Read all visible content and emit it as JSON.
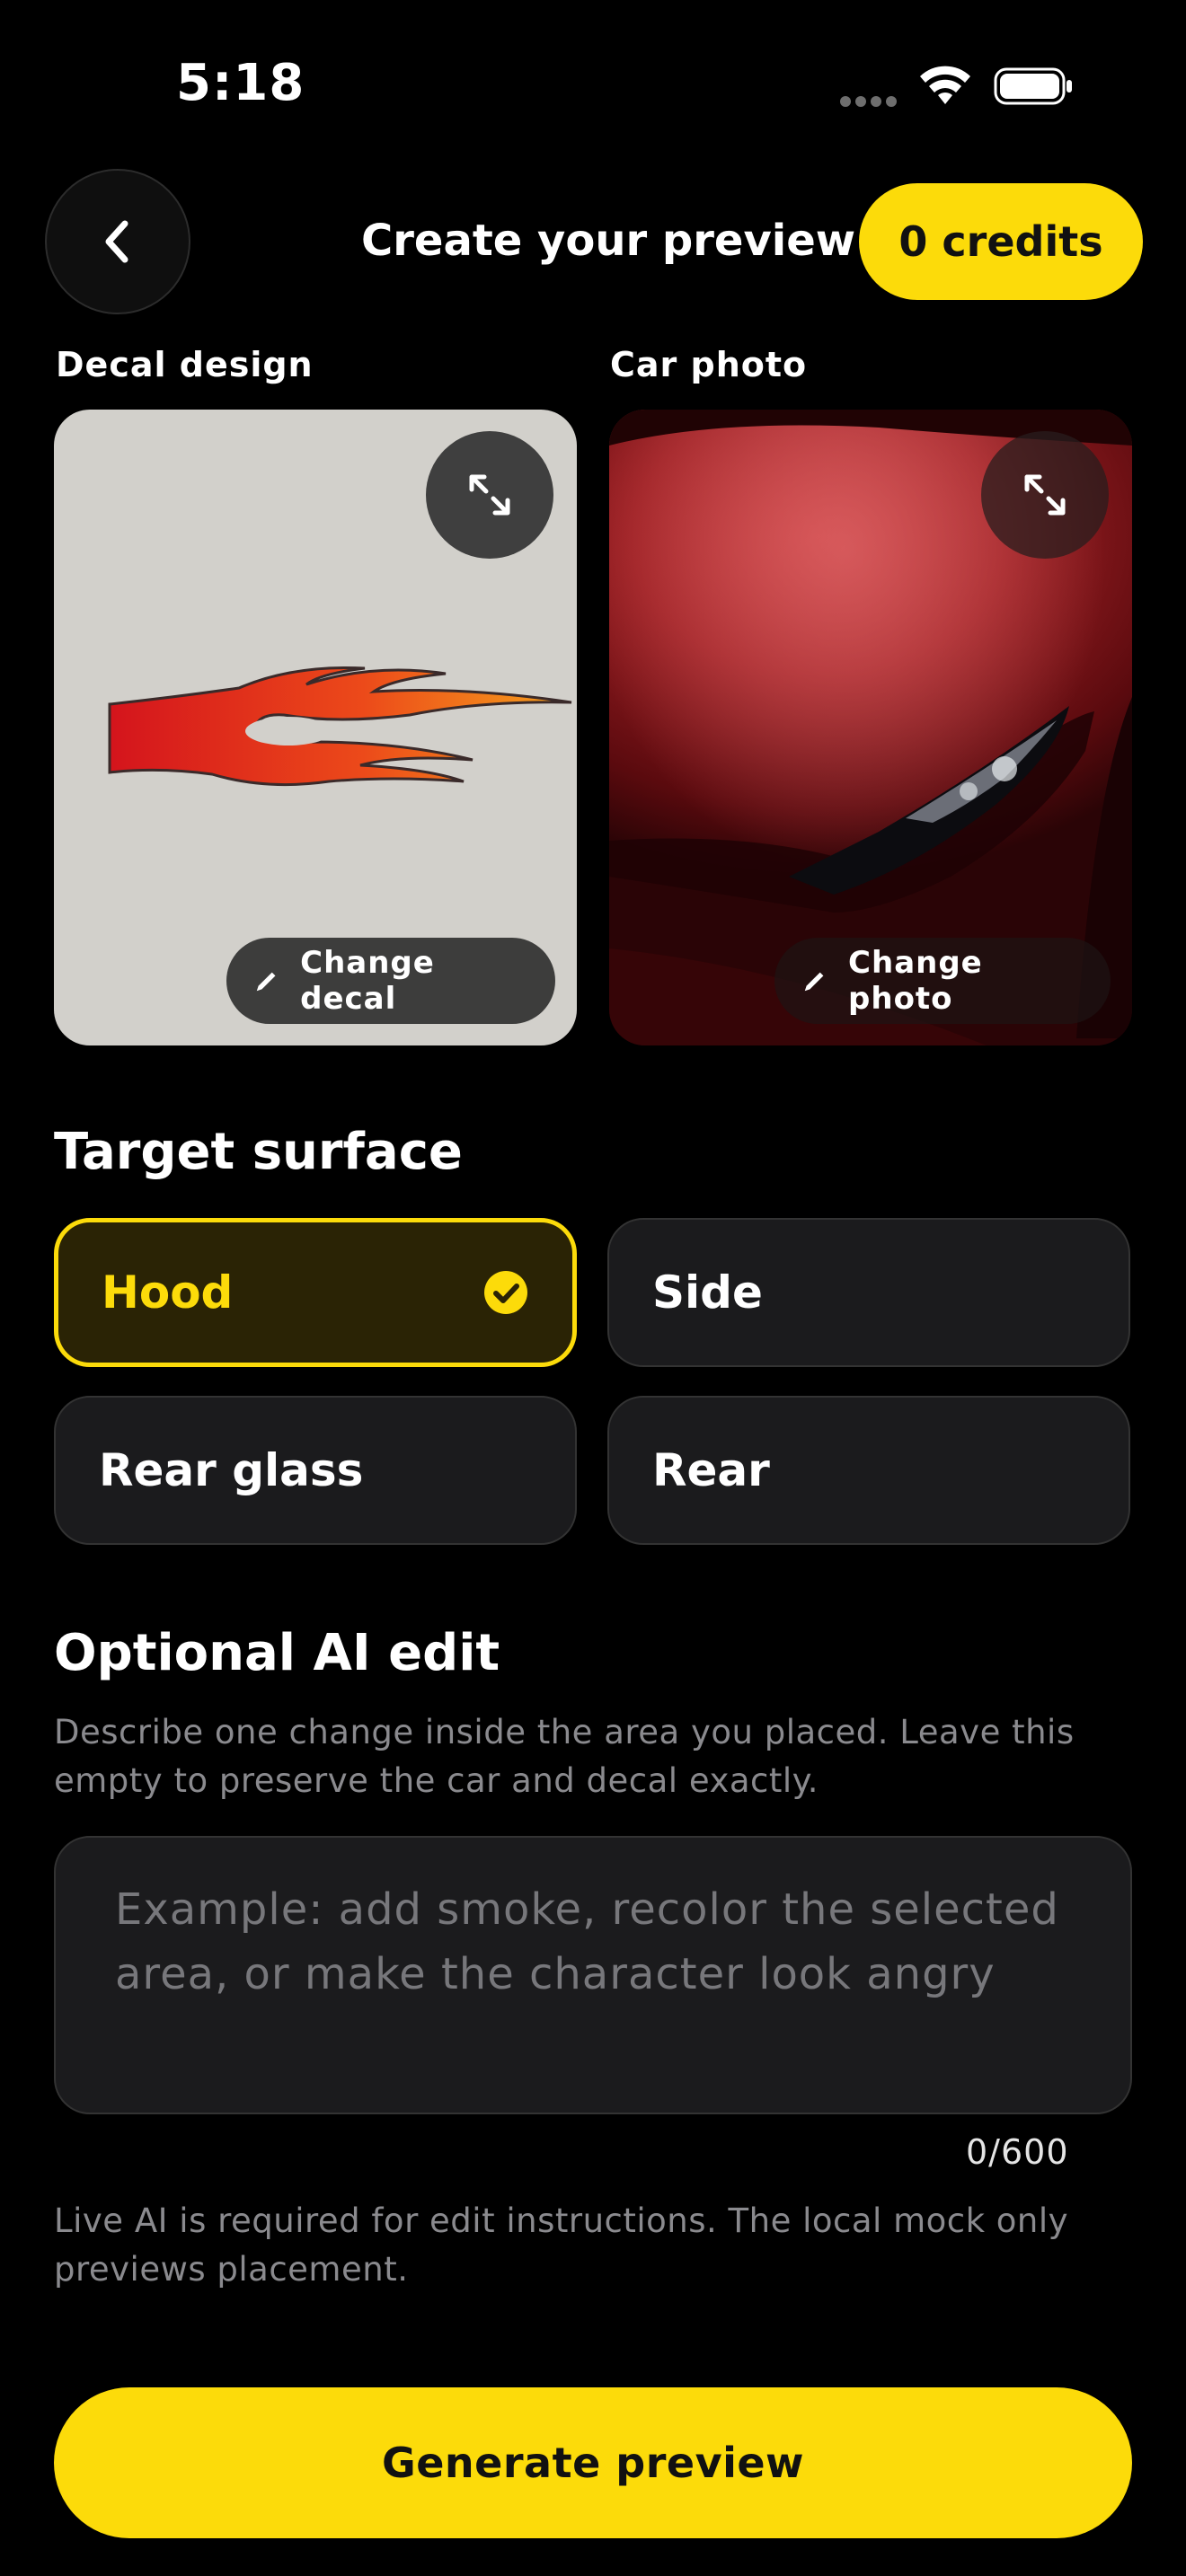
{
  "status_bar": {
    "time": "5:18"
  },
  "header": {
    "back_icon": "chevron-left-icon",
    "title": "Create your preview",
    "credits": "0 credits"
  },
  "decal": {
    "label": "Decal design",
    "change_label": "Change decal",
    "expand_icon": "expand-icon",
    "edit_icon": "pencil-icon"
  },
  "photo": {
    "label": "Car photo",
    "change_label": "Change photo",
    "expand_icon": "expand-icon",
    "edit_icon": "pencil-icon"
  },
  "target_surface": {
    "heading": "Target surface",
    "options": [
      {
        "label": "Hood",
        "selected": true
      },
      {
        "label": "Side",
        "selected": false
      },
      {
        "label": "Rear glass",
        "selected": false
      },
      {
        "label": "Rear",
        "selected": false
      }
    ]
  },
  "ai_edit": {
    "heading": "Optional AI edit",
    "description": "Describe one change inside the area you placed. Leave this empty to preserve the car and decal exactly.",
    "placeholder": "Example: add smoke, recolor the selected area, or make the character look angry",
    "value": "",
    "counter": "0/600",
    "note": "Live AI is required for edit instructions. The local mock only previews placement."
  },
  "generate_label": "Generate preview",
  "colors": {
    "accent": "#fcdb0a",
    "background": "#000000",
    "card": "#1b1b1d"
  }
}
